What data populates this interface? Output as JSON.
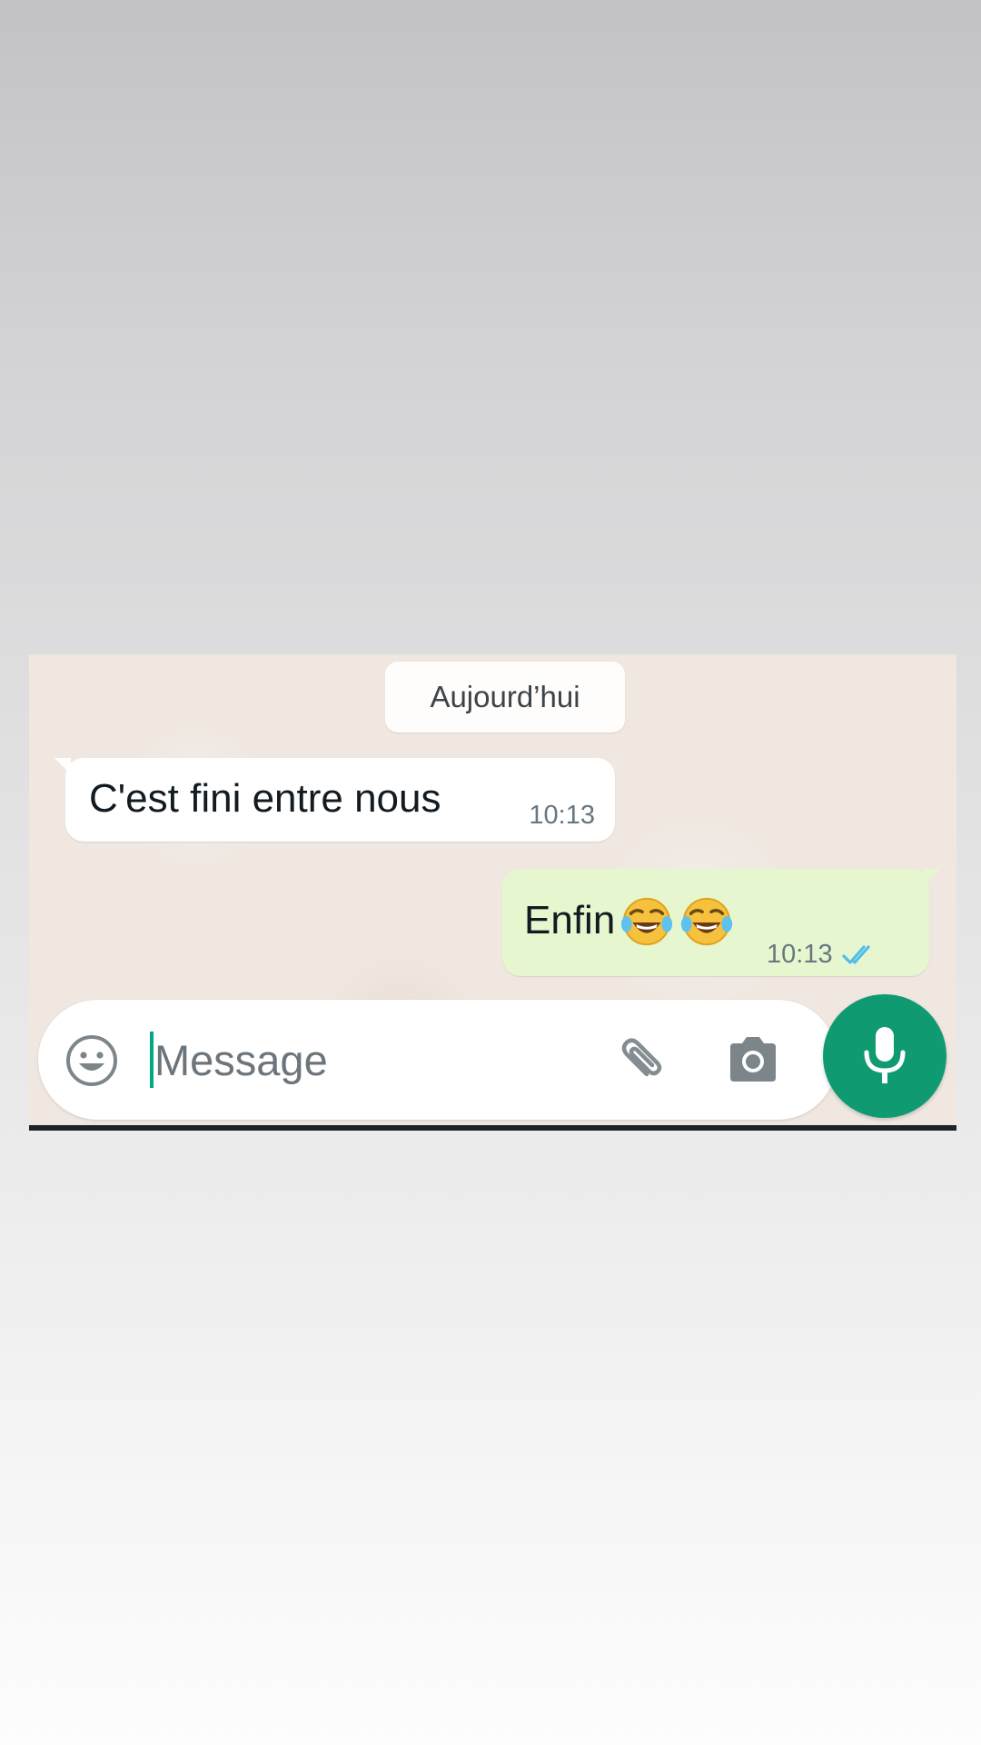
{
  "chat": {
    "date_chip": "Aujourd’hui",
    "messages": [
      {
        "direction": "incoming",
        "text": "C'est fini entre nous",
        "time": "10:13"
      },
      {
        "direction": "outgoing",
        "text": "Enfin",
        "emoji": [
          "face-with-tears-of-joy",
          "face-with-tears-of-joy"
        ],
        "time": "10:13",
        "status": "read"
      }
    ]
  },
  "composer": {
    "placeholder": "Message",
    "value": "",
    "icons": {
      "emoji": "smiley-icon",
      "attach": "paperclip-icon",
      "camera": "camera-icon",
      "mic": "microphone-icon"
    }
  },
  "colors": {
    "accent": "#0f9a72",
    "read_ticks": "#53bdeb",
    "outgoing_bubble": "#e6f7d0",
    "incoming_bubble": "#ffffff",
    "chat_background": "#efe7e0"
  }
}
